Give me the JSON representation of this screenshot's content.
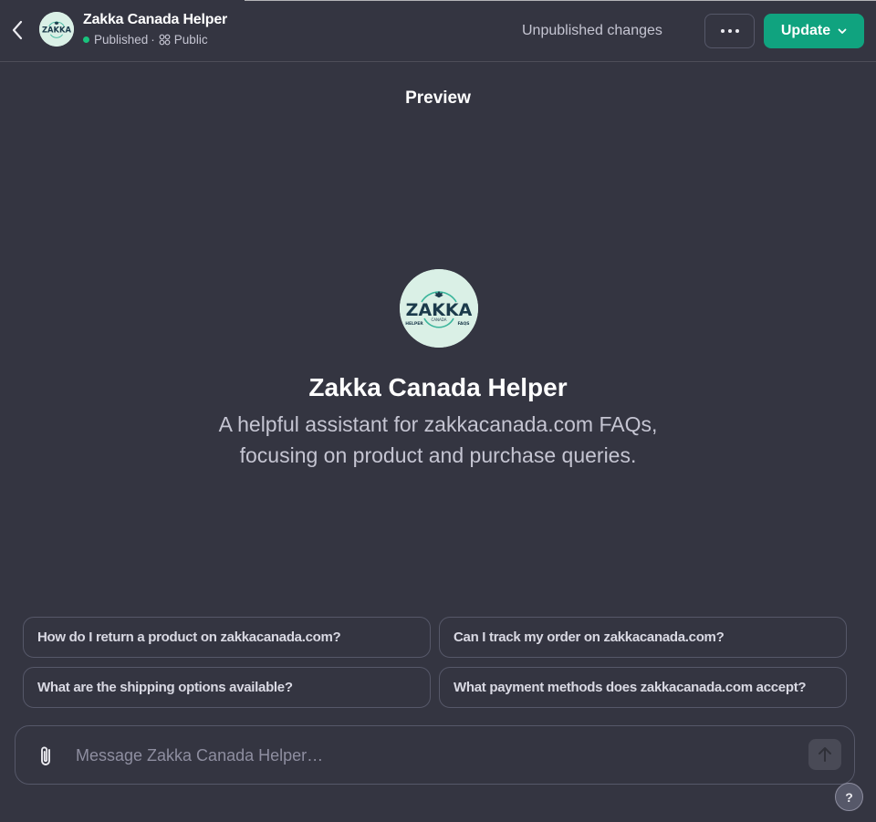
{
  "header": {
    "gpt_title": "Zakka Canada Helper",
    "status": "Published",
    "status_separator": "·",
    "visibility": "Public",
    "unpublished_text": "Unpublished changes",
    "update_label": "Update",
    "status_color": "#19c37d",
    "accent_color": "#10a37f"
  },
  "logo": {
    "wordmark": "ZAKKA",
    "sub": "CANADA",
    "left_tag": "HELPER",
    "right_tag": "FAQS"
  },
  "preview": {
    "label": "Preview",
    "name": "Zakka Canada Helper",
    "description_line1": "A helpful assistant for zakkacanada.com FAQs,",
    "description_line2": "focusing on product and purchase queries."
  },
  "starters": [
    {
      "label": "How do I return a product on zakkacanada.com?"
    },
    {
      "label": "Can I track my order on zakkacanada.com?"
    },
    {
      "label": "What are the shipping options available?"
    },
    {
      "label": "What payment methods does zakkacanada.com accept?"
    }
  ],
  "composer": {
    "placeholder": "Message Zakka Canada Helper…",
    "value": ""
  },
  "help": {
    "label": "?"
  }
}
